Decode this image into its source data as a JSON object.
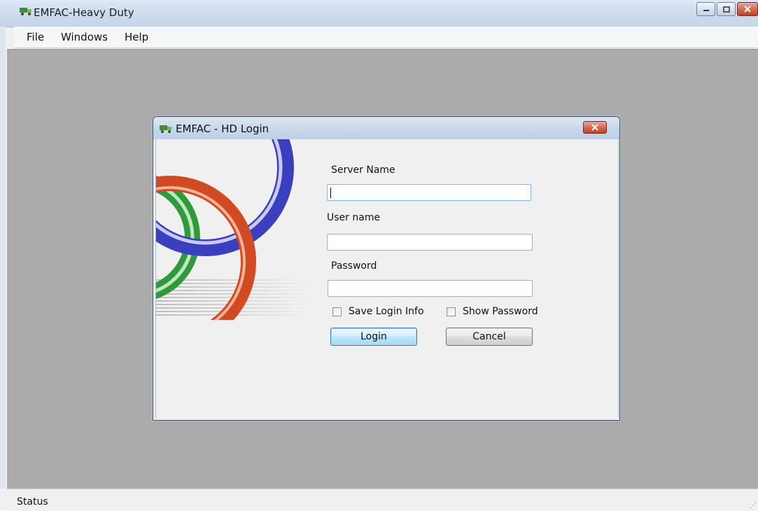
{
  "app": {
    "title": "EMFAC-Heavy Duty",
    "icon": "app-truck-icon"
  },
  "menu": {
    "items": [
      "File",
      "Windows",
      "Help"
    ]
  },
  "status": {
    "text": "Status"
  },
  "dialog": {
    "title": "EMFAC - HD Login",
    "icon": "app-truck-icon",
    "server_label": "Server Name",
    "server_value": "",
    "user_label": "User name",
    "user_value": "",
    "password_label": "Password",
    "password_value": "",
    "save_login_label": "Save Login Info",
    "save_login_checked": false,
    "show_password_label": "Show Password",
    "show_password_checked": false,
    "login_label": "Login",
    "cancel_label": "Cancel"
  },
  "colors": {
    "mdi_background": "#ababab",
    "close_button": "#c2401f",
    "ring_green": "#2f9a3a",
    "ring_blue": "#3a3fc0",
    "ring_red": "#d24a22"
  }
}
